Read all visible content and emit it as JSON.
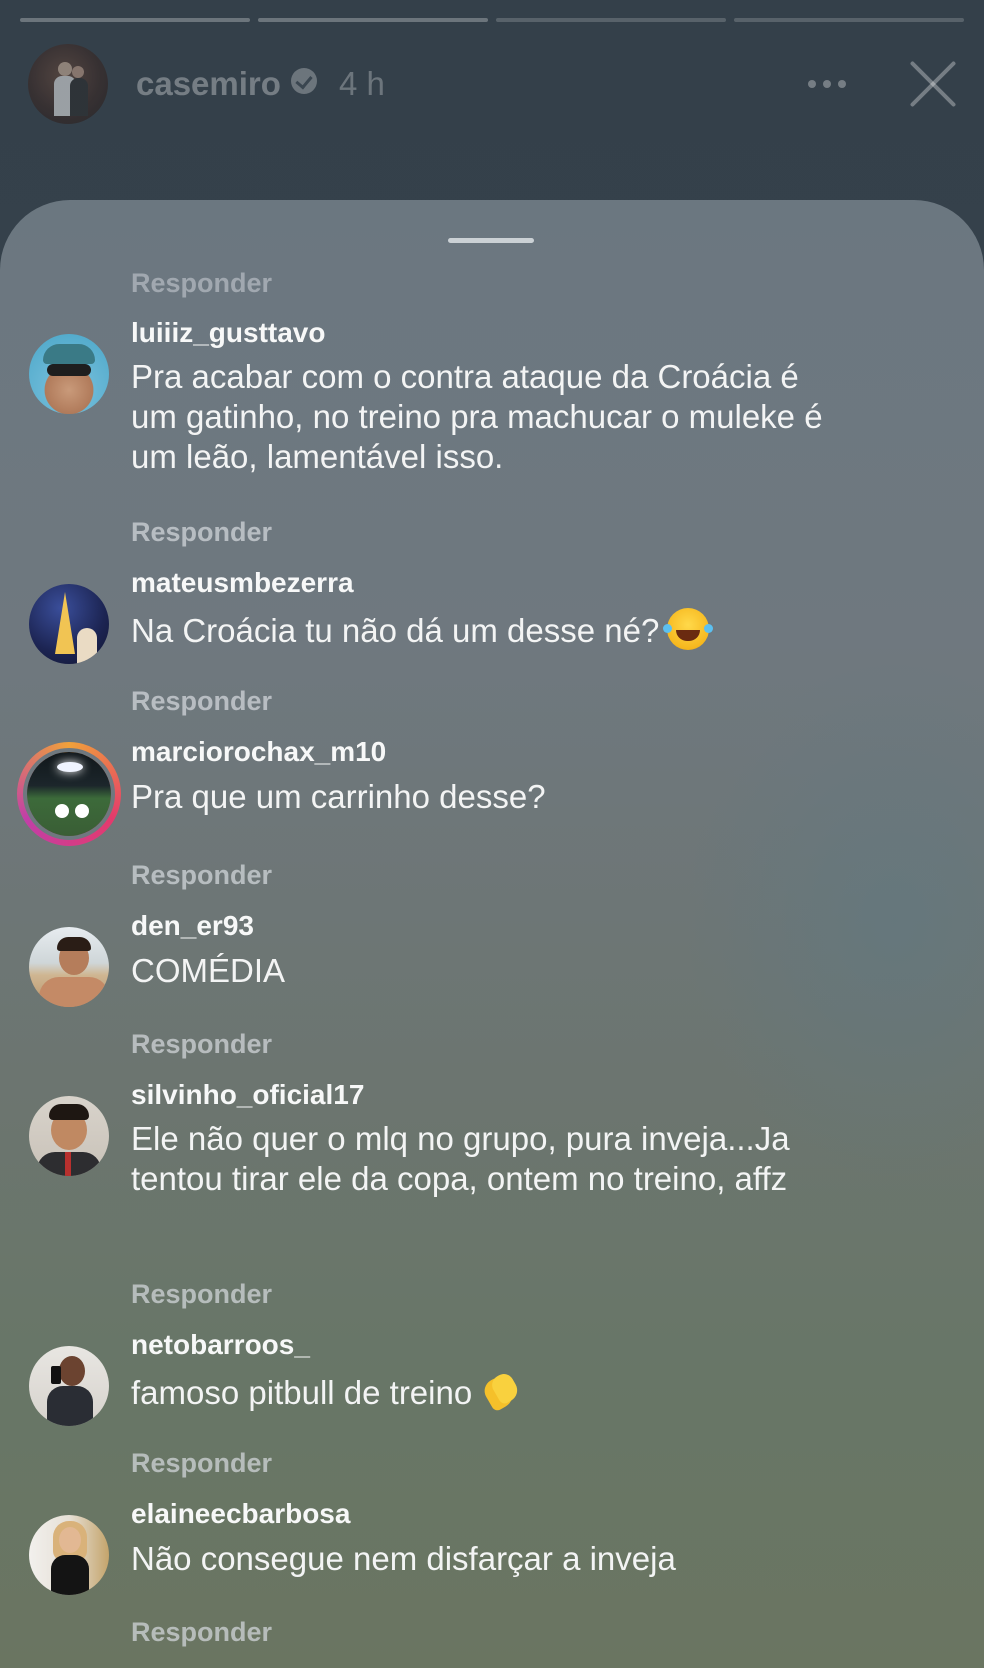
{
  "story": {
    "username": "casemiro",
    "time": "4 h",
    "progress_segments": 4
  },
  "sheet": {
    "top_reply_label": "Responder"
  },
  "comments": [
    {
      "username": "luiiiz_gusttavo",
      "text": "Pra acabar com o contra ataque da Croácia é um gatinho, no treino pra machucar o muleke é um leão, lamentável isso.",
      "reply": "Responder"
    },
    {
      "username": "mateusmbezerra",
      "text": "Na Croácia tu não dá um desse né?",
      "emoji": "face-with-tears-of-joy-icon",
      "reply": "Responder"
    },
    {
      "username": "marciorochax_m10",
      "text": "Pra que um carrinho desse?",
      "has_story_ring": true,
      "reply": "Responder"
    },
    {
      "username": "den_er93",
      "text": "COMÉDIA",
      "reply": "Responder"
    },
    {
      "username": "silvinho_oficial17",
      "text": "Ele não quer o mlq no grupo, pura inveja...Ja tentou tirar ele da copa, ontem no treino, affz",
      "reply": "Responder"
    },
    {
      "username": "netobarroos_",
      "text": "famoso pitbull de treino",
      "emoji": "clapping-hands-icon",
      "reply": "Responder"
    },
    {
      "username": "elaineecbarbosa",
      "text": "Não  consegue nem disfarçar a inveja",
      "reply": "Responder"
    }
  ]
}
